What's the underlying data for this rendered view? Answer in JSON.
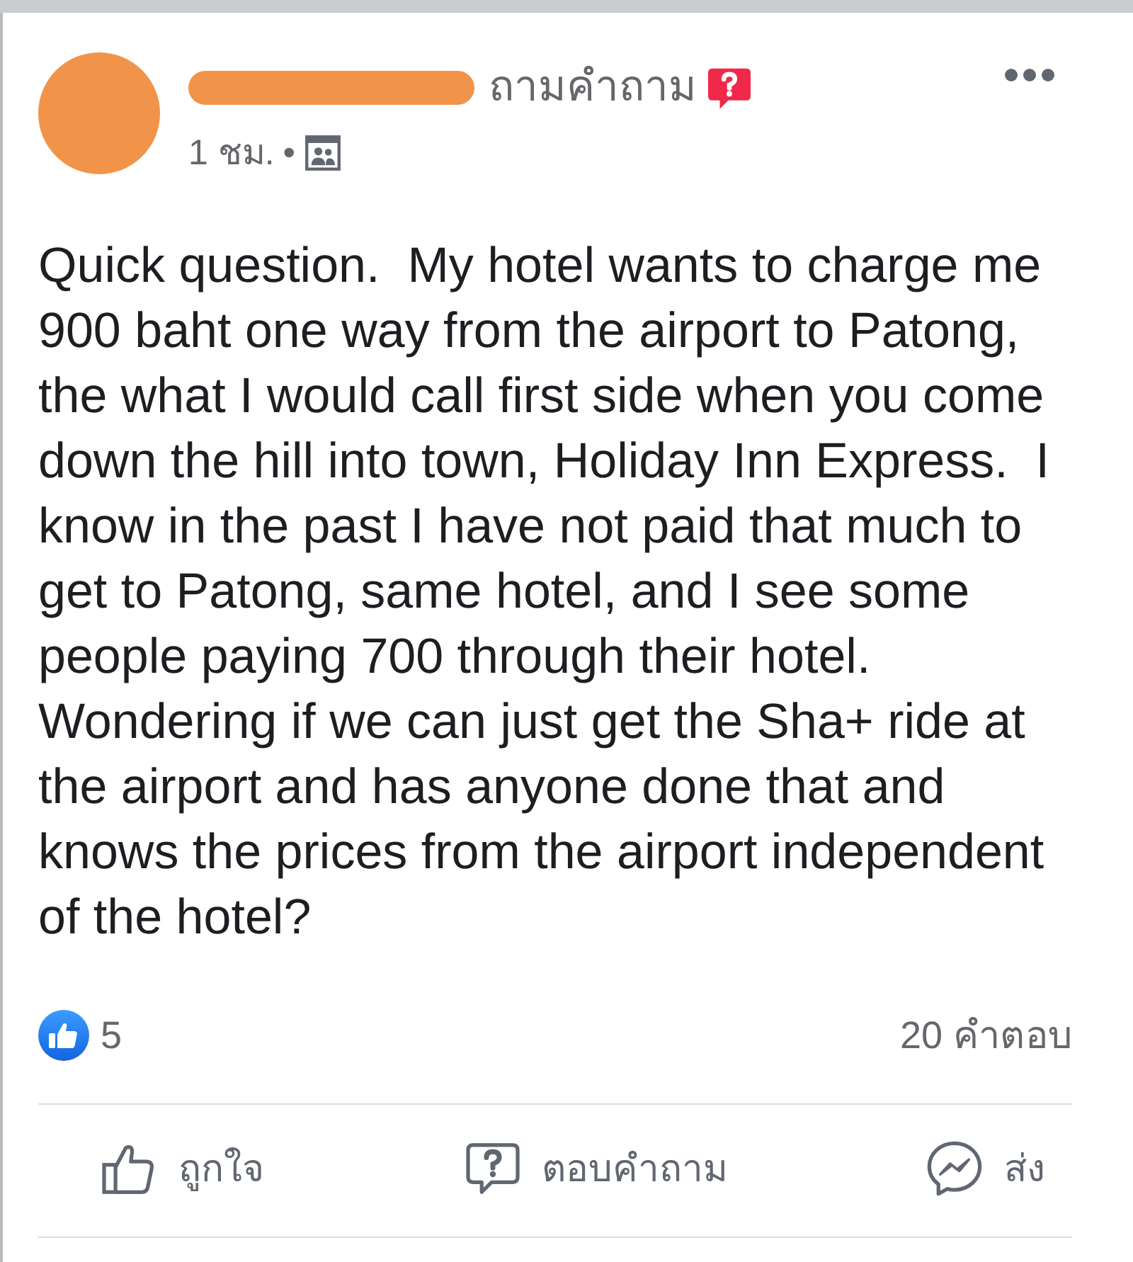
{
  "post": {
    "author": {
      "redacted": true
    },
    "activity": "ถามคำถาม",
    "time": "1 ชม.",
    "separator": "•",
    "body_lines": [
      "Quick question.  My hotel wants to charge me",
      "900 baht one way from the airport to Patong,",
      "the what I would call first side when you come",
      "down the hill into town, Holiday Inn Express.  I",
      "know in the past I have not paid that much to",
      "get to Patong, same hotel, and I see some",
      "people paying 700 through their hotel.",
      "Wondering if we can just get the Sha+ ride at",
      "the airport and has anyone done that and",
      "knows the prices from the airport independent",
      "of the hotel?"
    ],
    "reaction_count": "5",
    "answers": "20 คำตอบ",
    "actions": [
      {
        "kind": "like",
        "label": "ถูกใจ"
      },
      {
        "kind": "answer",
        "label": "ตอบคำถาม"
      },
      {
        "kind": "send",
        "label": "ส่ง"
      }
    ]
  }
}
